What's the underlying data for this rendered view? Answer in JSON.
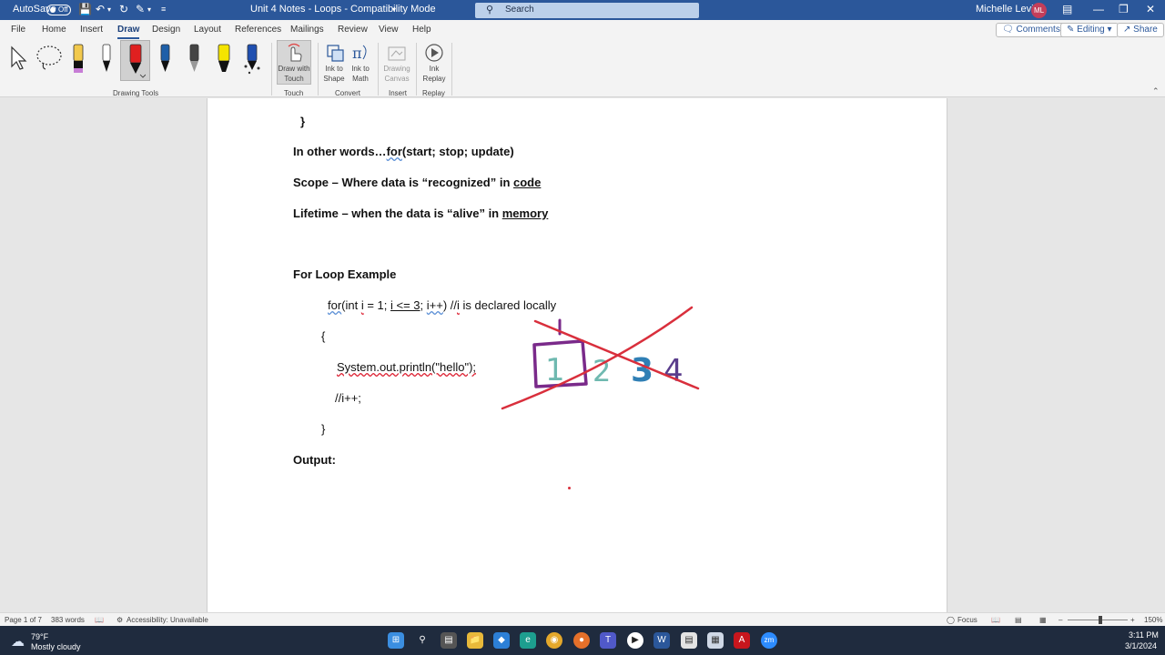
{
  "titlebar": {
    "autosave_label": "AutoSave",
    "autosave_state": "Off",
    "doc_title": "Unit 4 Notes - Loops  -  Compatibility Mode",
    "search_placeholder": "Search",
    "user_name": "Michelle Levine",
    "user_initials": "ML"
  },
  "menu": {
    "tabs": [
      "File",
      "Home",
      "Insert",
      "Draw",
      "Design",
      "Layout",
      "References",
      "Mailings",
      "Review",
      "View",
      "Help"
    ],
    "active_tab": "Draw",
    "comments_label": "Comments",
    "editing_label": "Editing",
    "share_label": "Share"
  },
  "ribbon": {
    "groups": {
      "drawing_tools": "Drawing Tools",
      "touch": "Touch",
      "convert": "Convert",
      "insert": "Insert",
      "replay": "Replay"
    },
    "draw_with_touch_1": "Draw with",
    "draw_with_touch_2": "Touch",
    "ink_to_shape_1": "Ink to",
    "ink_to_shape_2": "Shape",
    "ink_to_math_1": "Ink to",
    "ink_to_math_2": "Math",
    "drawing_canvas_1": "Drawing",
    "drawing_canvas_2": "Canvas",
    "ink_replay_1": "Ink",
    "ink_replay_2": "Replay",
    "pen_colors": [
      "#f2c94c",
      "#111111",
      "#e02020",
      "#1e5fa8",
      "#333333",
      "#f5e400",
      "#1f4fb0"
    ]
  },
  "document": {
    "brace_close_top": "}",
    "in_other_words_prefix": "In other words…",
    "in_other_words_for": "for",
    "in_other_words_rest": "(start; stop; update)",
    "scope_prefix": "Scope – Where data is “recognized” in ",
    "scope_link": "code",
    "lifetime_prefix": "Lifetime – when the data is “alive” in ",
    "lifetime_link": "memory",
    "for_loop_heading": "For Loop Example",
    "code_for": "for",
    "code_int": "(int ",
    "code_i1": "i",
    "code_eq": " = 1; ",
    "code_cond": "i <= 3",
    "code_semi": "; ",
    "code_inc": "i++",
    "code_paren": ") //",
    "code_i2": "i",
    "code_comment": " is declared locally",
    "open_brace": "{",
    "println": "System.out.println(\"hello\");",
    "comment_inc": "//i++;",
    "close_brace": "}",
    "output_label": "Output:",
    "ink_numbers": [
      "1",
      "2",
      "3",
      "4"
    ]
  },
  "status": {
    "page": "Page 1 of 7",
    "words": "383 words",
    "accessibility": "Accessibility: Unavailable",
    "focus": "Focus",
    "zoom": "150%"
  },
  "taskbar": {
    "weather_temp": "79°F",
    "weather_desc": "Mostly cloudy",
    "time": "3:11 PM",
    "date": "3/1/2024"
  }
}
